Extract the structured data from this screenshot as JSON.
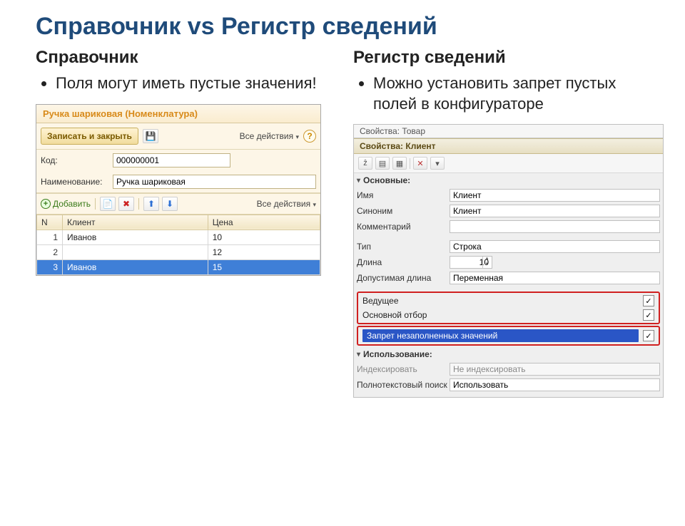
{
  "slide": {
    "title": "Справочник vs Регистр сведений",
    "left_subtitle": "Справочник",
    "right_subtitle": "Регистр сведений",
    "left_bullet": "Поля могут иметь пустые значения!",
    "right_bullet": "Можно установить запрет пустых полей в конфигураторе"
  },
  "left_window": {
    "title": "Ручка шариковая (Номенклатура)",
    "save_close": "Записать и закрыть",
    "all_actions": "Все действия",
    "code_label": "Код:",
    "code_value": "000000001",
    "name_label": "Наименование:",
    "name_value": "Ручка шариковая",
    "add": "Добавить",
    "all_actions2": "Все действия",
    "grid": {
      "col_n": "N",
      "col_client": "Клиент",
      "col_price": "Цена",
      "rows": [
        {
          "n": "1",
          "client": "Иванов",
          "price": "10",
          "selected": false
        },
        {
          "n": "2",
          "client": "",
          "price": "12",
          "selected": false
        },
        {
          "n": "3",
          "client": "Иванов",
          "price": "15",
          "selected": true
        }
      ]
    }
  },
  "palette": {
    "tab_dim": "Свойства: Товар",
    "tab_title": "Свойства: Клиент",
    "group_main": "Основные:",
    "name_label": "Имя",
    "name_value": "Клиент",
    "synonym_label": "Синоним",
    "synonym_value": "Клиент",
    "comment_label": "Комментарий",
    "comment_value": "",
    "type_label": "Тип",
    "type_value": "Строка",
    "length_label": "Длина",
    "length_value": "10",
    "allowed_len_label": "Допустимая длина",
    "allowed_len_value": "Переменная",
    "leading_label": "Ведущее",
    "main_filter_label": "Основной отбор",
    "no_empty_label": "Запрет незаполненных значений",
    "group_usage": "Использование:",
    "index_label": "Индексировать",
    "index_value": "Не индексировать",
    "fts_label": "Полнотекстовый поиск",
    "fts_value": "Использовать"
  }
}
